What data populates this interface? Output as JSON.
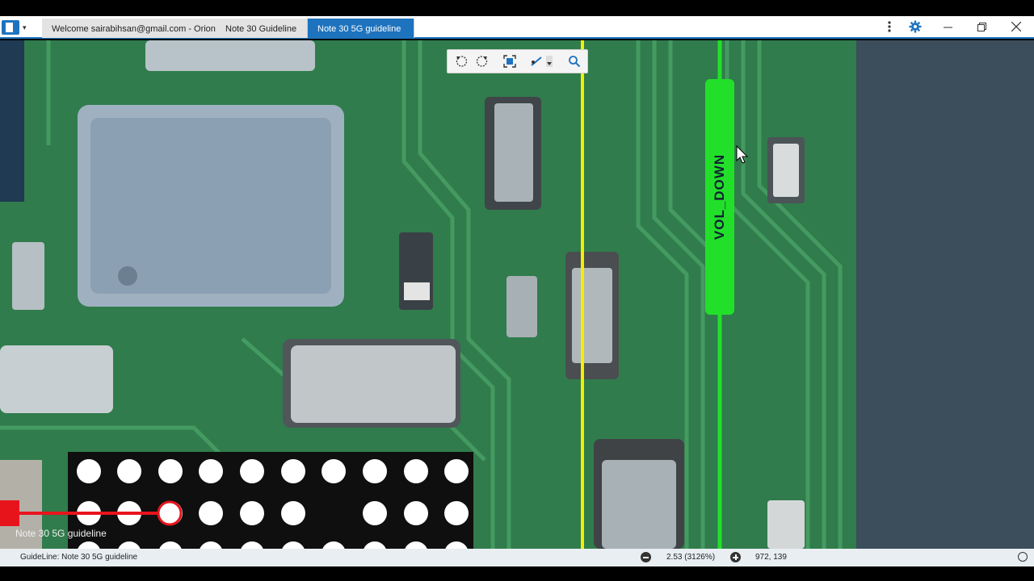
{
  "tabs": [
    {
      "label": "Welcome sairabihsan@gmail.com - Orion"
    },
    {
      "label": "Note 30 Guideline"
    },
    {
      "label": "Note 30 5G guideline"
    }
  ],
  "window_controls": {
    "minimize": "minimize",
    "maximize": "restore",
    "close": "close"
  },
  "toolbar": {
    "tools": [
      "rotate-left-icon",
      "rotate-right-icon",
      "fit-screen-icon",
      "line-tool-icon",
      "search-icon"
    ]
  },
  "board": {
    "net_label": "VOL_DOWN",
    "canvas_label": "Note 30 5G guideline"
  },
  "status": {
    "guideline": "GuideLine: Note 30 5G guideline",
    "zoom": "2.53 (3126%)",
    "coords": "972, 139"
  },
  "colors": {
    "accent": "#1e73be",
    "highlight_net": "#22e02a",
    "yellow_trace": "#f2f000",
    "red_trace": "#e8141c",
    "pcb": "#2f7a4a"
  }
}
